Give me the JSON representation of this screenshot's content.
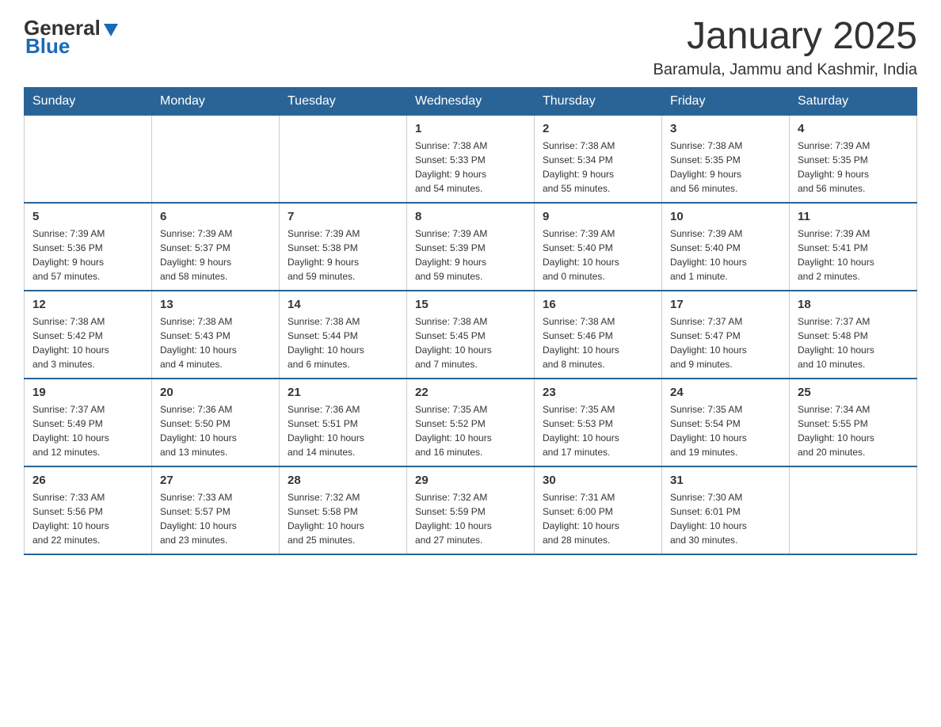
{
  "header": {
    "logo": {
      "text_general": "General",
      "text_blue": "Blue"
    },
    "title": "January 2025",
    "subtitle": "Baramula, Jammu and Kashmir, India"
  },
  "weekdays": [
    "Sunday",
    "Monday",
    "Tuesday",
    "Wednesday",
    "Thursday",
    "Friday",
    "Saturday"
  ],
  "weeks": [
    [
      {
        "day": "",
        "info": ""
      },
      {
        "day": "",
        "info": ""
      },
      {
        "day": "",
        "info": ""
      },
      {
        "day": "1",
        "info": "Sunrise: 7:38 AM\nSunset: 5:33 PM\nDaylight: 9 hours\nand 54 minutes."
      },
      {
        "day": "2",
        "info": "Sunrise: 7:38 AM\nSunset: 5:34 PM\nDaylight: 9 hours\nand 55 minutes."
      },
      {
        "day": "3",
        "info": "Sunrise: 7:38 AM\nSunset: 5:35 PM\nDaylight: 9 hours\nand 56 minutes."
      },
      {
        "day": "4",
        "info": "Sunrise: 7:39 AM\nSunset: 5:35 PM\nDaylight: 9 hours\nand 56 minutes."
      }
    ],
    [
      {
        "day": "5",
        "info": "Sunrise: 7:39 AM\nSunset: 5:36 PM\nDaylight: 9 hours\nand 57 minutes."
      },
      {
        "day": "6",
        "info": "Sunrise: 7:39 AM\nSunset: 5:37 PM\nDaylight: 9 hours\nand 58 minutes."
      },
      {
        "day": "7",
        "info": "Sunrise: 7:39 AM\nSunset: 5:38 PM\nDaylight: 9 hours\nand 59 minutes."
      },
      {
        "day": "8",
        "info": "Sunrise: 7:39 AM\nSunset: 5:39 PM\nDaylight: 9 hours\nand 59 minutes."
      },
      {
        "day": "9",
        "info": "Sunrise: 7:39 AM\nSunset: 5:40 PM\nDaylight: 10 hours\nand 0 minutes."
      },
      {
        "day": "10",
        "info": "Sunrise: 7:39 AM\nSunset: 5:40 PM\nDaylight: 10 hours\nand 1 minute."
      },
      {
        "day": "11",
        "info": "Sunrise: 7:39 AM\nSunset: 5:41 PM\nDaylight: 10 hours\nand 2 minutes."
      }
    ],
    [
      {
        "day": "12",
        "info": "Sunrise: 7:38 AM\nSunset: 5:42 PM\nDaylight: 10 hours\nand 3 minutes."
      },
      {
        "day": "13",
        "info": "Sunrise: 7:38 AM\nSunset: 5:43 PM\nDaylight: 10 hours\nand 4 minutes."
      },
      {
        "day": "14",
        "info": "Sunrise: 7:38 AM\nSunset: 5:44 PM\nDaylight: 10 hours\nand 6 minutes."
      },
      {
        "day": "15",
        "info": "Sunrise: 7:38 AM\nSunset: 5:45 PM\nDaylight: 10 hours\nand 7 minutes."
      },
      {
        "day": "16",
        "info": "Sunrise: 7:38 AM\nSunset: 5:46 PM\nDaylight: 10 hours\nand 8 minutes."
      },
      {
        "day": "17",
        "info": "Sunrise: 7:37 AM\nSunset: 5:47 PM\nDaylight: 10 hours\nand 9 minutes."
      },
      {
        "day": "18",
        "info": "Sunrise: 7:37 AM\nSunset: 5:48 PM\nDaylight: 10 hours\nand 10 minutes."
      }
    ],
    [
      {
        "day": "19",
        "info": "Sunrise: 7:37 AM\nSunset: 5:49 PM\nDaylight: 10 hours\nand 12 minutes."
      },
      {
        "day": "20",
        "info": "Sunrise: 7:36 AM\nSunset: 5:50 PM\nDaylight: 10 hours\nand 13 minutes."
      },
      {
        "day": "21",
        "info": "Sunrise: 7:36 AM\nSunset: 5:51 PM\nDaylight: 10 hours\nand 14 minutes."
      },
      {
        "day": "22",
        "info": "Sunrise: 7:35 AM\nSunset: 5:52 PM\nDaylight: 10 hours\nand 16 minutes."
      },
      {
        "day": "23",
        "info": "Sunrise: 7:35 AM\nSunset: 5:53 PM\nDaylight: 10 hours\nand 17 minutes."
      },
      {
        "day": "24",
        "info": "Sunrise: 7:35 AM\nSunset: 5:54 PM\nDaylight: 10 hours\nand 19 minutes."
      },
      {
        "day": "25",
        "info": "Sunrise: 7:34 AM\nSunset: 5:55 PM\nDaylight: 10 hours\nand 20 minutes."
      }
    ],
    [
      {
        "day": "26",
        "info": "Sunrise: 7:33 AM\nSunset: 5:56 PM\nDaylight: 10 hours\nand 22 minutes."
      },
      {
        "day": "27",
        "info": "Sunrise: 7:33 AM\nSunset: 5:57 PM\nDaylight: 10 hours\nand 23 minutes."
      },
      {
        "day": "28",
        "info": "Sunrise: 7:32 AM\nSunset: 5:58 PM\nDaylight: 10 hours\nand 25 minutes."
      },
      {
        "day": "29",
        "info": "Sunrise: 7:32 AM\nSunset: 5:59 PM\nDaylight: 10 hours\nand 27 minutes."
      },
      {
        "day": "30",
        "info": "Sunrise: 7:31 AM\nSunset: 6:00 PM\nDaylight: 10 hours\nand 28 minutes."
      },
      {
        "day": "31",
        "info": "Sunrise: 7:30 AM\nSunset: 6:01 PM\nDaylight: 10 hours\nand 30 minutes."
      },
      {
        "day": "",
        "info": ""
      }
    ]
  ]
}
